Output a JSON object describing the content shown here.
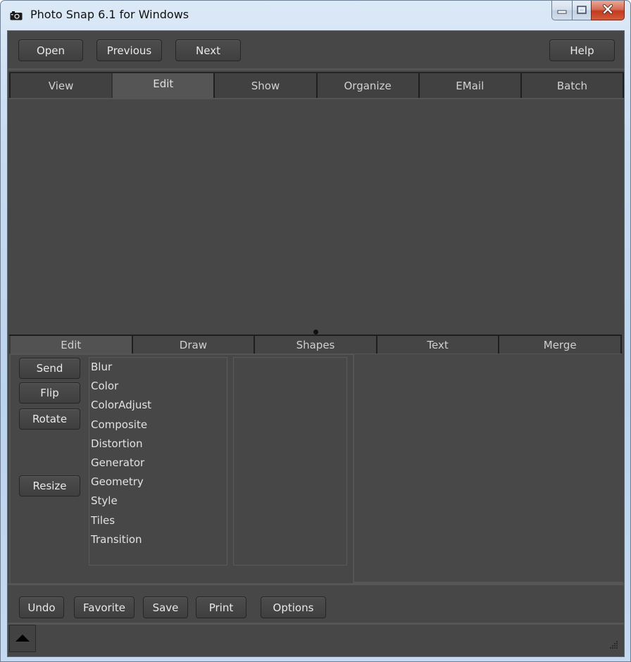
{
  "window": {
    "title": "Photo Snap 6.1 for Windows",
    "icons": {
      "app": "camera-icon",
      "minimize": "minimize-icon",
      "maximize": "maximize-icon",
      "close": "close-icon"
    }
  },
  "toolbar": {
    "open_label": "Open",
    "previous_label": "Previous",
    "next_label": "Next",
    "help_label": "Help"
  },
  "main_tabs": [
    {
      "label": "View",
      "active": false
    },
    {
      "label": "Edit",
      "active": true
    },
    {
      "label": "Show",
      "active": false
    },
    {
      "label": "Organize",
      "active": false
    },
    {
      "label": "EMail",
      "active": false
    },
    {
      "label": "Batch",
      "active": false
    }
  ],
  "sub_tabs": [
    {
      "label": "Edit",
      "active": true
    },
    {
      "label": "Draw",
      "active": false
    },
    {
      "label": "Shapes",
      "active": false
    },
    {
      "label": "Text",
      "active": false
    },
    {
      "label": "Merge",
      "active": false
    }
  ],
  "edit_actions": {
    "send_label": "Send",
    "flip_label": "Flip",
    "rotate_label": "Rotate",
    "resize_label": "Resize"
  },
  "filter_categories": [
    "Blur",
    "Color",
    "ColorAdjust",
    "Composite",
    "Distortion",
    "Generator",
    "Geometry",
    "Style",
    "Tiles",
    "Transition"
  ],
  "bottom_bar": {
    "undo_label": "Undo",
    "favorite_label": "Favorite",
    "save_label": "Save",
    "print_label": "Print",
    "options_label": "Options"
  },
  "status_bar": {
    "toggle_icon": "triangle-up-icon",
    "grip_icon": "resize-grip-icon"
  },
  "colors": {
    "background": "#474747",
    "button_text": "#e8e8e8",
    "close_button": "#c23b1f"
  }
}
